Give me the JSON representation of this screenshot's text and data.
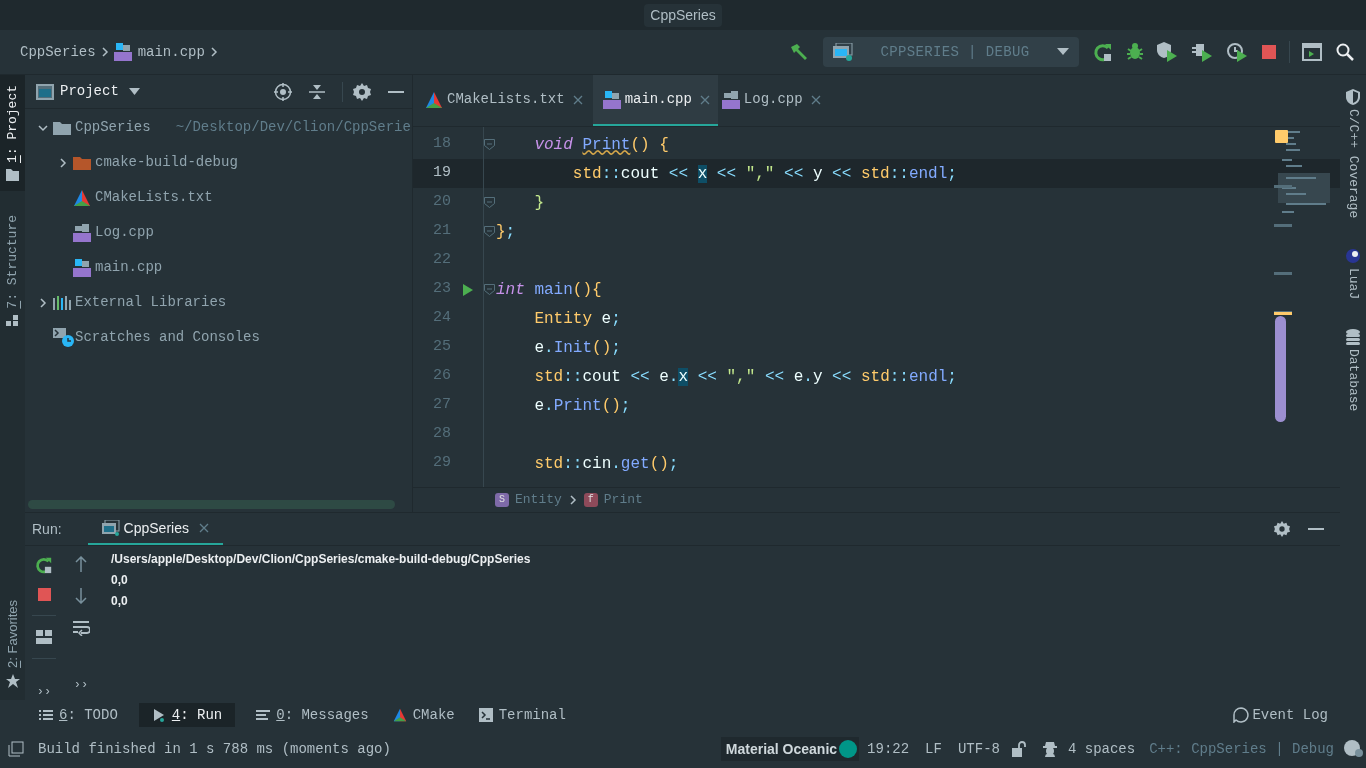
{
  "window": {
    "title": "CppSeries"
  },
  "breadcrumbs": [
    {
      "label": "CppSeries"
    },
    {
      "label": "main.cpp",
      "kind": "cpp"
    }
  ],
  "run_config": {
    "label": "CPPSERIES | DEBUG"
  },
  "left_stripe": [
    {
      "label": "1: Project",
      "selected": true
    },
    {
      "label": "7: Structure",
      "selected": false
    }
  ],
  "project_panel": {
    "title": "Project",
    "tree": [
      {
        "label": "CppSeries",
        "detail": "~/Desktop/Dev/Clion/CppSerie",
        "kind": "folder",
        "expanded": true,
        "children": [
          {
            "label": "cmake-build-debug",
            "kind": "buildfolder",
            "expanded": false
          },
          {
            "label": "CMakeLists.txt",
            "kind": "cmake"
          },
          {
            "label": "Log.cpp",
            "kind": "source"
          },
          {
            "label": "main.cpp",
            "kind": "cpp"
          }
        ]
      },
      {
        "label": "External Libraries",
        "kind": "library",
        "expanded": false
      },
      {
        "label": "Scratches and Consoles",
        "kind": "scratch"
      }
    ]
  },
  "editor_tabs": [
    {
      "label": "CMakeLists.txt",
      "kind": "cmake",
      "selected": false
    },
    {
      "label": "main.cpp",
      "kind": "cpp",
      "selected": true
    },
    {
      "label": "Log.cpp",
      "kind": "source",
      "selected": false
    }
  ],
  "code_lines": [
    {
      "number": "18",
      "current": false,
      "fold": true,
      "runnable": false,
      "tokens": [
        {
          "kind": "kw",
          "text": "    void "
        },
        {
          "kind": "fnwarn",
          "text": "Print"
        },
        {
          "kind": "type",
          "text": "() {"
        }
      ]
    },
    {
      "number": "19",
      "current": true,
      "fold": false,
      "runnable": false,
      "tokens": [
        {
          "kind": "type",
          "text": "        std"
        },
        {
          "kind": "op",
          "text": "::"
        },
        {
          "kind": "plain",
          "text": "cout"
        },
        {
          "kind": "op",
          "text": " << "
        },
        {
          "kind": "hl",
          "text": "x"
        },
        {
          "kind": "op",
          "text": " << "
        },
        {
          "kind": "str",
          "text": "\",\""
        },
        {
          "kind": "op",
          "text": " << "
        },
        {
          "kind": "plain",
          "text": "y"
        },
        {
          "kind": "op",
          "text": " << "
        },
        {
          "kind": "type",
          "text": "std"
        },
        {
          "kind": "op",
          "text": "::"
        },
        {
          "kind": "fn",
          "text": "endl"
        },
        {
          "kind": "op",
          "text": ";"
        }
      ]
    },
    {
      "number": "20",
      "current": false,
      "fold": true,
      "runnable": false,
      "tokens": [
        {
          "kind": "brace",
          "text": "    }"
        }
      ]
    },
    {
      "number": "21",
      "current": false,
      "fold": true,
      "runnable": false,
      "tokens": [
        {
          "kind": "type",
          "text": "}"
        },
        {
          "kind": "op",
          "text": ";"
        }
      ]
    },
    {
      "number": "22",
      "current": false,
      "fold": false,
      "runnable": false
    },
    {
      "number": "23",
      "current": false,
      "fold": true,
      "runnable": true,
      "tokens": [
        {
          "kind": "kw",
          "text": "int "
        },
        {
          "kind": "fn",
          "text": "main"
        },
        {
          "kind": "type",
          "text": "(){"
        }
      ]
    },
    {
      "number": "24",
      "current": false,
      "fold": false,
      "runnable": false,
      "tokens": [
        {
          "kind": "type",
          "text": "    Entity"
        },
        {
          "kind": "plain",
          "text": " e"
        },
        {
          "kind": "op",
          "text": ";"
        }
      ]
    },
    {
      "number": "25",
      "current": false,
      "fold": false,
      "runnable": false,
      "tokens": [
        {
          "kind": "plain",
          "text": "    e"
        },
        {
          "kind": "op",
          "text": "."
        },
        {
          "kind": "fn",
          "text": "Init"
        },
        {
          "kind": "type",
          "text": "()"
        },
        {
          "kind": "op",
          "text": ";"
        }
      ]
    },
    {
      "number": "26",
      "current": false,
      "fold": false,
      "runnable": false,
      "tokens": [
        {
          "kind": "type",
          "text": "    std"
        },
        {
          "kind": "op",
          "text": "::"
        },
        {
          "kind": "plain",
          "text": "cout"
        },
        {
          "kind": "op",
          "text": " << "
        },
        {
          "kind": "plain",
          "text": "e"
        },
        {
          "kind": "op",
          "text": "."
        },
        {
          "kind": "hl",
          "text": "x"
        },
        {
          "kind": "op",
          "text": " << "
        },
        {
          "kind": "str",
          "text": "\",\""
        },
        {
          "kind": "op",
          "text": " << "
        },
        {
          "kind": "plain",
          "text": "e"
        },
        {
          "kind": "op",
          "text": "."
        },
        {
          "kind": "plain",
          "text": "y"
        },
        {
          "kind": "op",
          "text": " << "
        },
        {
          "kind": "type",
          "text": "std"
        },
        {
          "kind": "op",
          "text": "::"
        },
        {
          "kind": "fn",
          "text": "endl"
        },
        {
          "kind": "op",
          "text": ";"
        }
      ]
    },
    {
      "number": "27",
      "current": false,
      "fold": false,
      "runnable": false,
      "tokens": [
        {
          "kind": "plain",
          "text": "    e"
        },
        {
          "kind": "op",
          "text": "."
        },
        {
          "kind": "fn",
          "text": "Print"
        },
        {
          "kind": "type",
          "text": "()"
        },
        {
          "kind": "op",
          "text": ";"
        }
      ]
    },
    {
      "number": "28",
      "current": false,
      "fold": false,
      "runnable": false
    },
    {
      "number": "29",
      "current": false,
      "fold": false,
      "runnable": false,
      "tokens": [
        {
          "kind": "type",
          "text": "    std"
        },
        {
          "kind": "op",
          "text": "::"
        },
        {
          "kind": "plain",
          "text": "cin"
        },
        {
          "kind": "op",
          "text": "."
        },
        {
          "kind": "fn",
          "text": "get"
        },
        {
          "kind": "type",
          "text": "()"
        },
        {
          "kind": "op",
          "text": ";"
        }
      ]
    }
  ],
  "code_breadcrumbs": [
    {
      "label": "Entity",
      "kind": "struct",
      "letter": "S"
    },
    {
      "label": "Print",
      "kind": "function",
      "letter": "f"
    }
  ],
  "right_stripe": [
    {
      "label": "C/C++ Coverage",
      "kind": "shield"
    },
    {
      "label": "LuaJ",
      "kind": "moon"
    },
    {
      "label": "Database",
      "kind": "database"
    }
  ],
  "run_panel": {
    "title": "Run:",
    "tab": {
      "label": "CppSeries",
      "selected": true
    },
    "output": [
      "/Users/apple/Desktop/Dev/Clion/CppSeries/cmake-build-debug/CppSeries",
      "0,0",
      "0,0"
    ],
    "more": [
      "››",
      "››"
    ]
  },
  "favorites": {
    "label": "2: Favorites"
  },
  "tool_tabs": [
    {
      "label": "6: TODO",
      "kind": "list",
      "selected": false
    },
    {
      "label": "4: Run",
      "kind": "run",
      "selected": true
    },
    {
      "label": "0: Messages",
      "kind": "messages",
      "selected": false
    },
    {
      "label": "CMake",
      "kind": "cmake",
      "selected": false
    },
    {
      "label": "Terminal",
      "kind": "terminal",
      "selected": false
    }
  ],
  "event_log": "Event Log",
  "status_bar": {
    "message": "Build finished in 1 s 788 ms (moments ago)",
    "theme": "Material Oceanic",
    "position": "19:22",
    "line_separator": "LF",
    "encoding": "UTF-8",
    "indent": "4 spaces",
    "context": "C++: CppSeries | Debug"
  }
}
